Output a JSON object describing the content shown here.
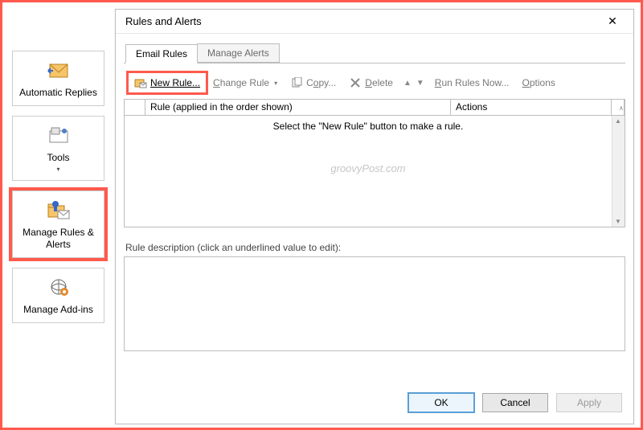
{
  "sidebar": {
    "items": [
      {
        "label": "Automatic Replies"
      },
      {
        "label": "Tools"
      },
      {
        "label": "Manage Rules & Alerts"
      },
      {
        "label": "Manage Add-ins"
      }
    ]
  },
  "dialog": {
    "title": "Rules and Alerts",
    "tabs": {
      "active": "Email Rules",
      "inactive": "Manage Alerts"
    },
    "toolbar": {
      "new_rule": "New Rule...",
      "change_rule": "Change Rule",
      "copy": "Copy...",
      "delete": "Delete",
      "run_rules": "Run Rules Now...",
      "options": "Options"
    },
    "grid": {
      "col_rule": "Rule (applied in the order shown)",
      "col_actions": "Actions",
      "empty_text": "Select the \"New Rule\" button to make a rule."
    },
    "watermark": "groovyPost.com",
    "desc_label": "Rule description (click an underlined value to edit):",
    "buttons": {
      "ok": "OK",
      "cancel": "Cancel",
      "apply": "Apply"
    }
  }
}
